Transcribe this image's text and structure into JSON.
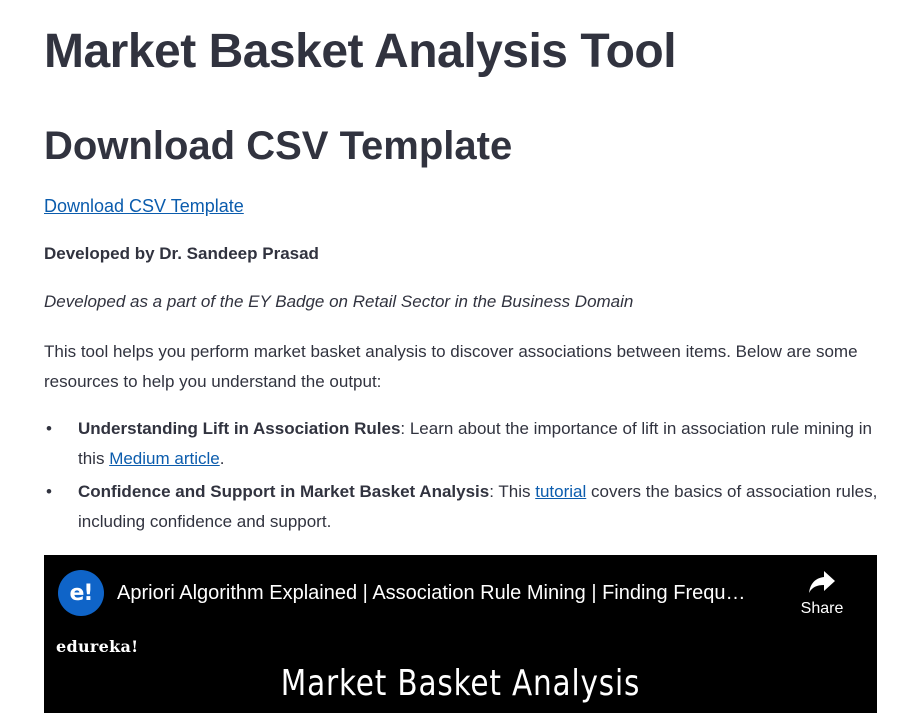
{
  "header": {
    "title": "Market Basket Analysis Tool",
    "subtitle": "Download CSV Template"
  },
  "download": {
    "link_label": "Download CSV Template"
  },
  "credits": {
    "developer": "Developed by Dr. Sandeep Prasad",
    "context": "Developed as a part of the EY Badge on Retail Sector in the Business Domain"
  },
  "intro": {
    "text": "This tool helps you perform market basket analysis to discover associations between items. Below are some resources to help you understand the output:"
  },
  "resources": [
    {
      "bold": "Understanding Lift in Association Rules",
      "before": ": Learn about the importance of lift in association rule mining in this ",
      "link": "Medium article",
      "after": "."
    },
    {
      "bold": "Confidence and Support in Market Basket Analysis",
      "before": ": This ",
      "link": "tutorial",
      "after": " covers the basics of association rules, including confidence and support."
    }
  ],
  "video": {
    "channel_logo_text": "e!",
    "title": "Apriori Algorithm Explained | Association Rule Mining | Finding Frequ…",
    "share_label": "Share",
    "brand": "edureka!",
    "heading": "Market Basket Analysis",
    "share_icon": "share-arrow-icon"
  },
  "colors": {
    "text": "#31333f",
    "link": "#0b5cad",
    "video_bg": "#000000",
    "channel_logo": "#0f64c8"
  }
}
